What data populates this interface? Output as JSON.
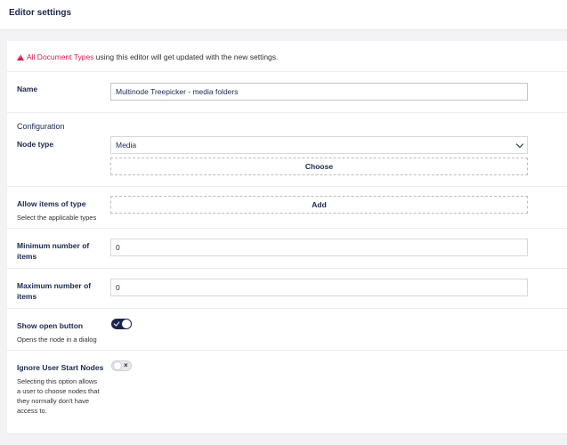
{
  "header": {
    "title": "Editor settings"
  },
  "warning": {
    "icon": "alert-triangle-icon",
    "link": "All Document Types",
    "text": " using this editor will get updated with the new settings."
  },
  "name_field": {
    "label": "Name",
    "value": "Multinode Treepicker - media folders"
  },
  "configuration": {
    "title": "Configuration"
  },
  "node_type": {
    "label": "Node type",
    "selected": "Media",
    "choose_label": "Choose"
  },
  "allow_items": {
    "label": "Allow items of type",
    "description": "Select the applicable types",
    "add_label": "Add"
  },
  "min_items": {
    "label_line1": "Minimum number of",
    "label_line2": "items",
    "value": "0"
  },
  "max_items": {
    "label_line1": "Maximum number of",
    "label_line2": "items",
    "value": "0"
  },
  "show_open": {
    "label": "Show open button",
    "description": "Opens the node in a dialog",
    "enabled": true
  },
  "ignore_start": {
    "label": "Ignore User Start Nodes",
    "description_lines": [
      "Selecting this option allows",
      "a user to choose nodes that",
      "they normally don't have",
      "access to."
    ],
    "enabled": false
  },
  "colors": {
    "accent": "#d42054",
    "primary": "#1b264f"
  }
}
